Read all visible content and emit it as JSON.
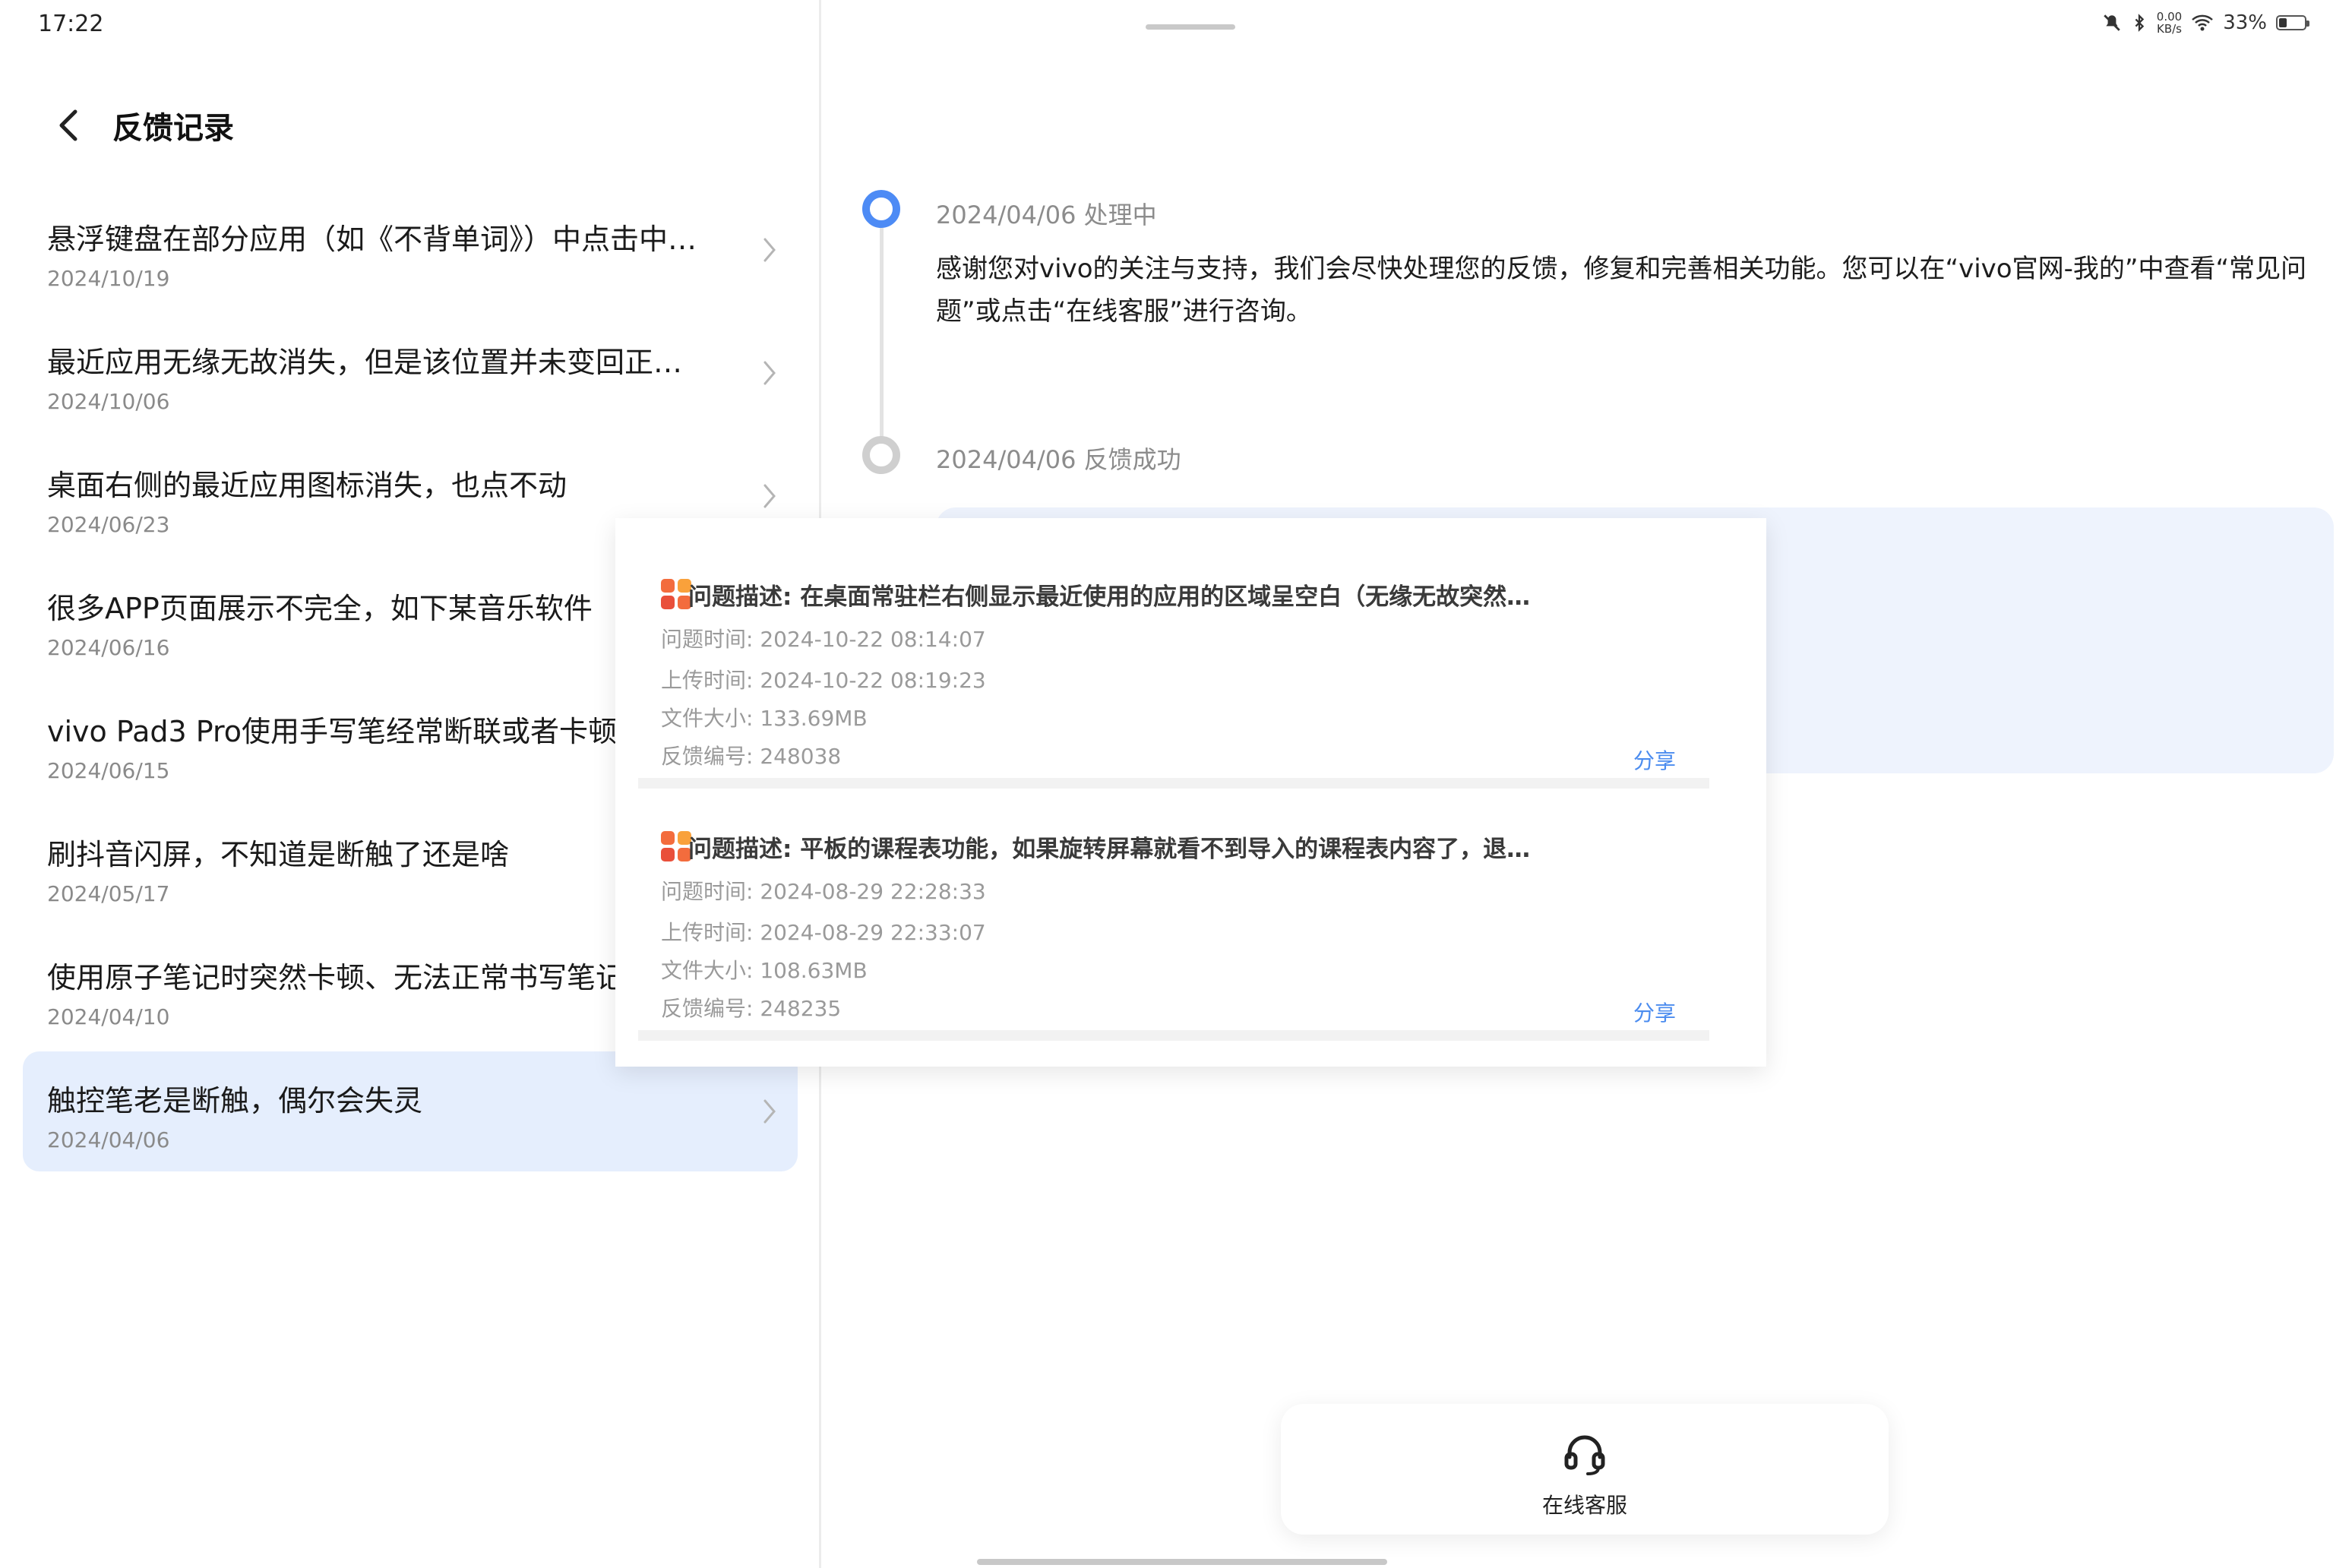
{
  "status_bar": {
    "time": "17:22",
    "net_speed_value": "0.00",
    "net_speed_unit": "KB/s",
    "battery_percent": "33%",
    "battery_level": 0.33
  },
  "header": {
    "title": "反馈记录"
  },
  "feedback_list": [
    {
      "title": "悬浮键盘在部分应用（如《不背单词》）中点击中…",
      "date": "2024/10/19"
    },
    {
      "title": "最近应用无缘无故消失，但是该位置并未变回正…",
      "date": "2024/10/06"
    },
    {
      "title": "桌面右侧的最近应用图标消失，也点不动",
      "date": "2024/06/23"
    },
    {
      "title": "很多APP页面展示不完全，如下某音乐软件",
      "date": "2024/06/16"
    },
    {
      "title": "vivo Pad3 Pro使用手写笔经常断联或者卡顿",
      "date": "2024/06/15"
    },
    {
      "title": "刷抖音闪屏，不知道是断触了还是啥",
      "date": "2024/05/17"
    },
    {
      "title": "使用原子笔记时突然卡顿、无法正常书写笔记",
      "date": "2024/04/10"
    },
    {
      "title": "触控笔老是断触，偶尔会失灵",
      "date": "2024/04/06"
    }
  ],
  "timeline": {
    "step1_heading": "2024/04/06 处理中",
    "step1_text": "感谢您对vivo的关注与支持，我们会尽快处理您的反馈，修复和完善相关功能。您可以在“vivo官网-我的”中查看“常见问题”或点击“在线客服”进行咨询。",
    "step2_heading": "2024/04/06 反馈成功"
  },
  "popup": {
    "cards": [
      {
        "title": "问题描述: 在桌面常驻栏右侧显示最近使用的应用的区域呈空白（无缘无故突然…",
        "issue_time": "问题时间: 2024-10-22 08:14:07",
        "upload_time": "上传时间: 2024-10-22 08:19:23",
        "file_size": "文件大小: 133.69MB",
        "feedback_id": "反馈编号: 248038",
        "share_label": "分享"
      },
      {
        "title": "问题描述: 平板的课程表功能，如果旋转屏幕就看不到导入的课程表内容了，退…",
        "issue_time": "问题时间: 2024-08-29 22:28:33",
        "upload_time": "上传时间: 2024-08-29 22:33:07",
        "file_size": "文件大小: 108.63MB",
        "feedback_id": "反馈编号: 248235",
        "share_label": "分享"
      }
    ]
  },
  "customer_service": {
    "label": "在线客服",
    "icon": "headset-icon"
  },
  "colors": {
    "accent": "#4d8bf5",
    "selected_bg": "#e5eefd",
    "share": "#4b8cef"
  }
}
